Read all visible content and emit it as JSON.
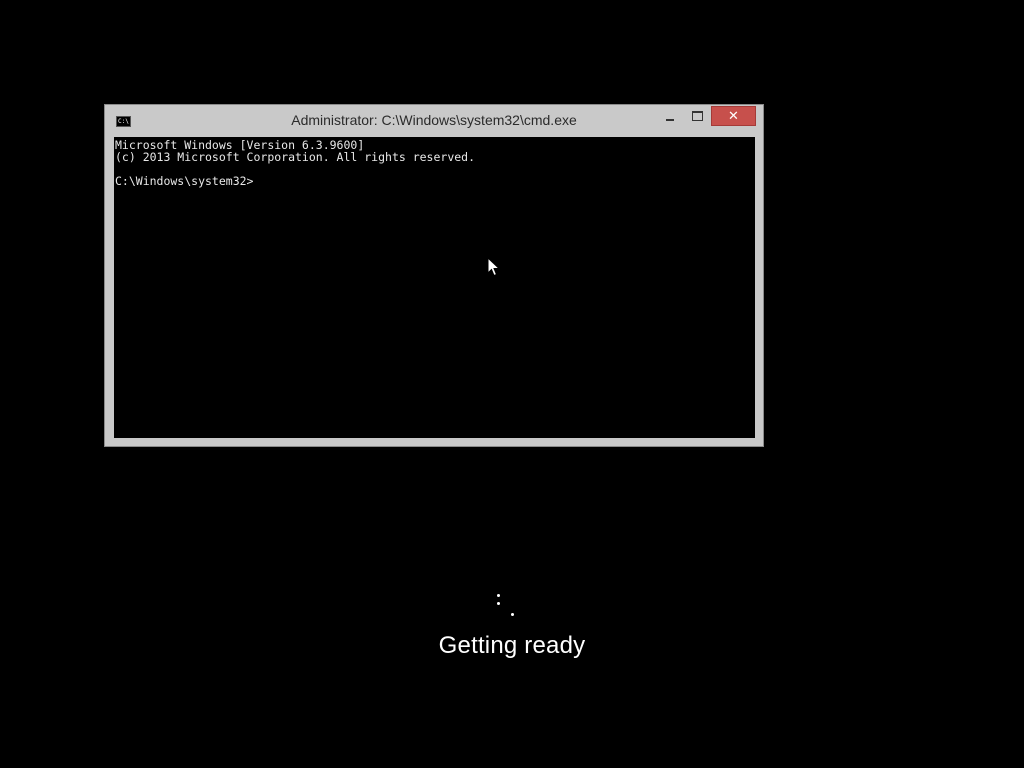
{
  "window": {
    "title": "Administrator: C:\\Windows\\system32\\cmd.exe",
    "icon_label": "C:\\",
    "buttons": {
      "minimize": "minimize",
      "maximize": "maximize",
      "close": "✕"
    }
  },
  "console": {
    "lines": [
      "Microsoft Windows [Version 6.3.9600]",
      "(c) 2013 Microsoft Corporation. All rights reserved.",
      "",
      "C:\\Windows\\system32>"
    ]
  },
  "setup": {
    "status": "Getting ready",
    "spinner_icon": "loading-spinner-icon"
  },
  "colors": {
    "background": "#000000",
    "window_frame": "#c9c9c9",
    "close_button": "#c7504c",
    "console_text": "#e8e8e8"
  }
}
